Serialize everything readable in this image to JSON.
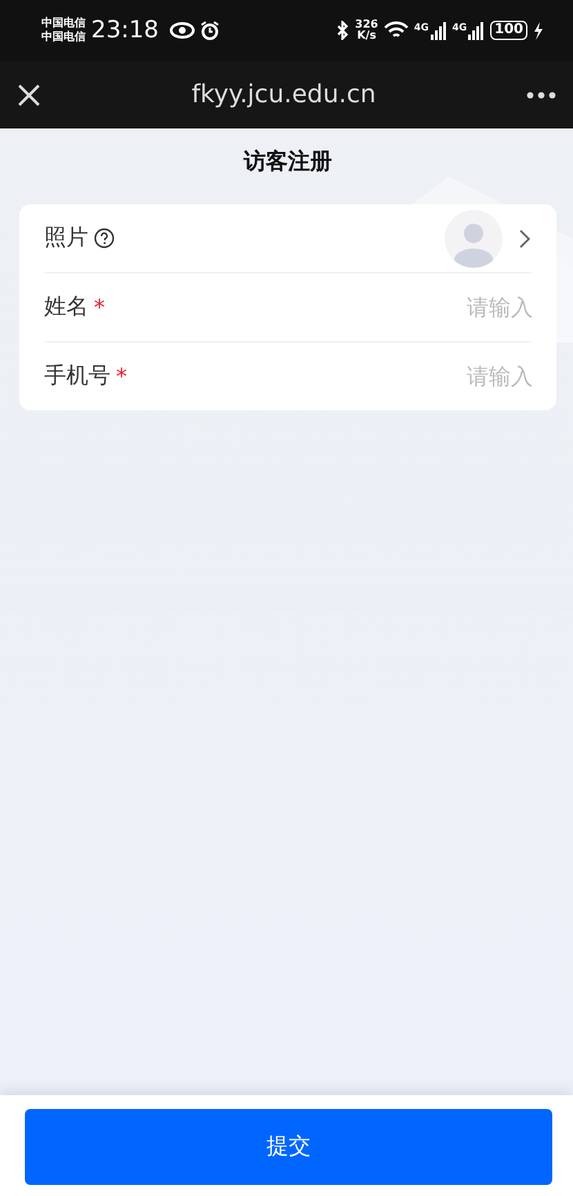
{
  "status_bar": {
    "carriers": [
      "中国电信",
      "中国电信"
    ],
    "time": "23:18",
    "network_speed": "326",
    "network_unit": "K/s",
    "signal_labels": [
      "4G",
      "4G"
    ],
    "battery": "100"
  },
  "browser_bar": {
    "url": "fkyy.jcu.edu.cn"
  },
  "page_title": "访客注册",
  "form_rows": [
    {
      "kind": "photo",
      "label": "照片"
    },
    {
      "kind": "input",
      "label": "姓名",
      "mark": "*",
      "placeholder": "请输入"
    },
    {
      "kind": "input",
      "label": "手机号",
      "mark": "*",
      "placeholder": "请输入"
    }
  ],
  "submit_button": "提交"
}
